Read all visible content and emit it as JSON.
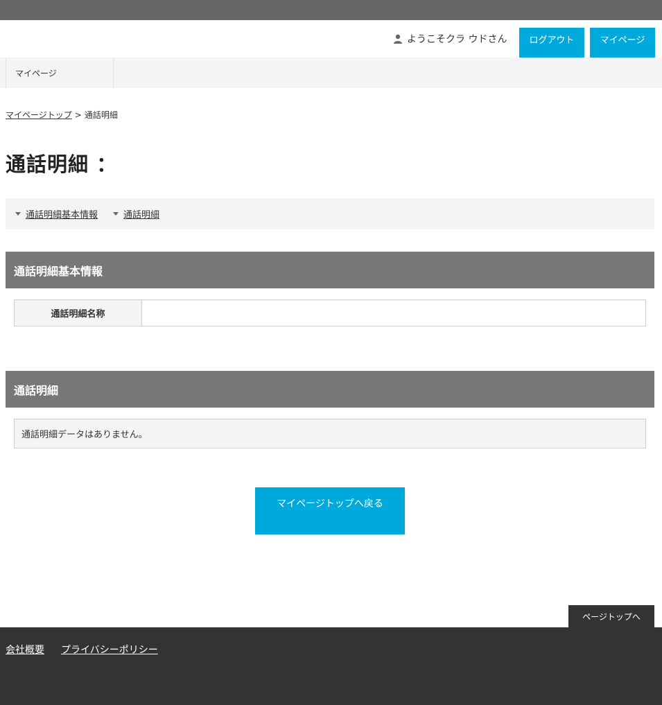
{
  "header": {
    "greeting": "ようこそクラ ウドさん",
    "user_icon": "user-icon",
    "logout_label": "ログアウト",
    "mypage_label": "マイページ"
  },
  "nav": {
    "items": [
      {
        "label": "マイページ"
      }
    ]
  },
  "breadcrumb": {
    "home": "マイページトップ ",
    "separator": ">",
    "current": "通話明細"
  },
  "page": {
    "title": "通話明細 ："
  },
  "anchors": {
    "items": [
      {
        "label": "通話明細基本情報"
      },
      {
        "label": "通話明細"
      }
    ]
  },
  "sections": {
    "basic": {
      "heading": "通話明細基本情報",
      "rows": [
        {
          "label": "通話明細名称",
          "value": ""
        }
      ]
    },
    "detail": {
      "heading": "通話明細",
      "empty_message": "通話明細データはありません。"
    }
  },
  "actions": {
    "back_label": "マイページトップへ戻る",
    "pagetop_label": "ページトップへ"
  },
  "footer": {
    "links": [
      {
        "label": "会社概要"
      },
      {
        "label": "プライバシーポリシー"
      }
    ]
  },
  "colors": {
    "accent": "#00a9dc",
    "topbar": "#666666",
    "section_header": "#777777",
    "footer": "#333333",
    "panel": "#f4f4f4"
  }
}
